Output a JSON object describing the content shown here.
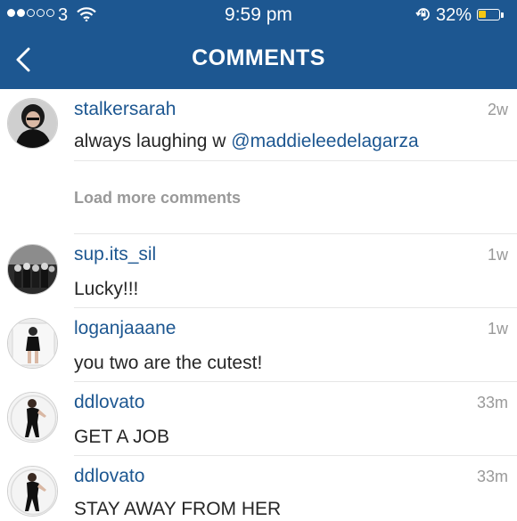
{
  "status_bar": {
    "carrier": "3",
    "time": "9:59 pm",
    "battery_percent": "32%",
    "battery_level": 0.32,
    "signal_bars": 2
  },
  "header": {
    "title": "COMMENTS",
    "back_icon": "chevron-left-icon",
    "background_color": "#1d5791"
  },
  "caption": {
    "username": "stalkersarah",
    "text": "always laughing w ",
    "mention": "@maddieleedelagarza",
    "time": "2w"
  },
  "load_more": "Load more comments",
  "comments": [
    {
      "username": "sup.its_sil",
      "text": "Lucky!!!",
      "time": "1w"
    },
    {
      "username": "loganjaaane",
      "text": "you two are the cutest!",
      "time": "1w"
    },
    {
      "username": "ddlovato",
      "text": "GET A JOB",
      "time": "33m"
    },
    {
      "username": "ddlovato",
      "text": "STAY AWAY FROM HER",
      "time": "33m"
    }
  ],
  "colors": {
    "link": "#1d5791",
    "text": "#262626",
    "meta": "#999999",
    "battery": "#f3c614"
  }
}
